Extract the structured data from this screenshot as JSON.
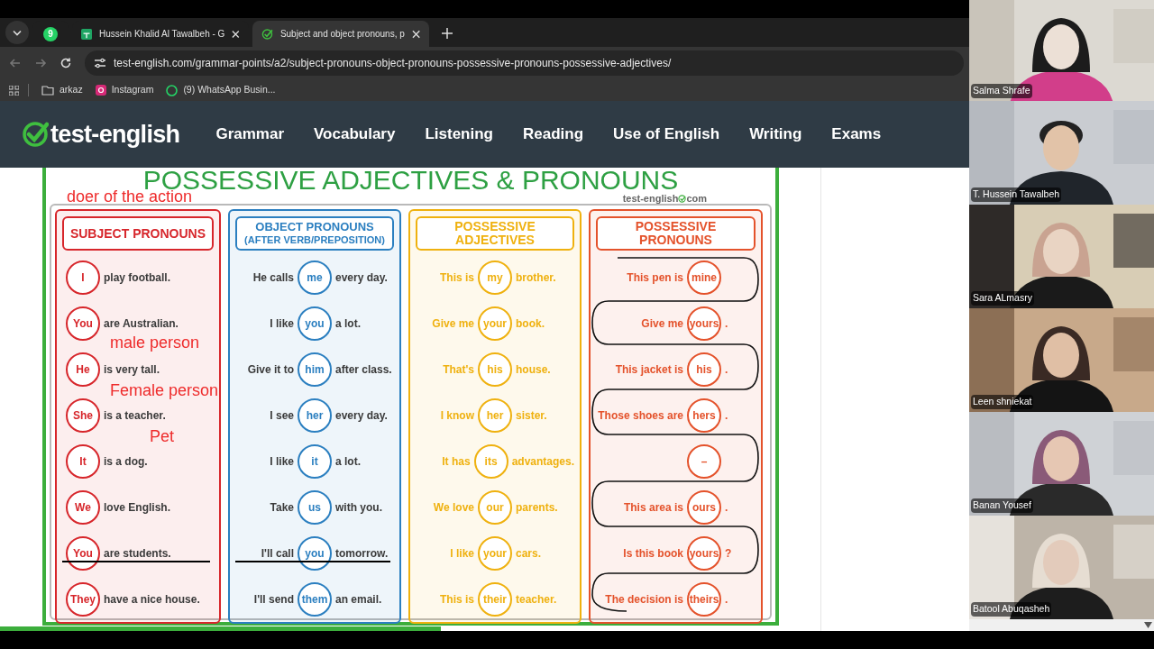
{
  "browser": {
    "tabs": [
      {
        "kind": "pinned",
        "badge": "9",
        "selected": false
      },
      {
        "kind": "sheet",
        "title": "Hussein Khalid Al Tawalbeh - G",
        "selected": false
      },
      {
        "kind": "check",
        "title": "Subject and object pronouns, p",
        "selected": true
      }
    ],
    "url": "test-english.com/grammar-points/a2/subject-pronouns-object-pronouns-possessive-pronouns-possessive-adjectives/",
    "bookmarks": [
      {
        "kind": "folder",
        "label": "arkaz"
      },
      {
        "kind": "instagram",
        "label": "Instagram"
      },
      {
        "kind": "whatsapp",
        "label": "(9) WhatsApp Busin..."
      }
    ]
  },
  "site": {
    "logo": "test-english",
    "nav": [
      "Grammar",
      "Vocabulary",
      "Listening",
      "Reading",
      "Use of English",
      "Writing",
      "Exams"
    ]
  },
  "chart": {
    "title": "POSSESSIVE ADJECTIVES & PRONOUNS",
    "brand": "test-english",
    "brand_suffix": "com",
    "columns": [
      {
        "title": "SUBJECT PRONOUNS",
        "color": "#d7262b",
        "colored_text": false,
        "rows": [
          {
            "word": "I",
            "after": "play football.",
            "struck": false
          },
          {
            "word": "You",
            "after": "are Australian.",
            "struck": false
          },
          {
            "word": "He",
            "after": "is very tall.",
            "struck": false
          },
          {
            "word": "She",
            "after": "is a teacher.",
            "struck": false
          },
          {
            "word": "It",
            "after": "is a dog.",
            "struck": false
          },
          {
            "word": "We",
            "after": "love English.",
            "struck": false
          },
          {
            "word": "You",
            "after": "are students.",
            "struck": true
          },
          {
            "word": "They",
            "after": "have a nice house.",
            "struck": false
          }
        ]
      },
      {
        "title": "OBJECT PRONOUNS",
        "subtitle": "(AFTER VERB/PREPOSITION)",
        "color": "#2b7fc0",
        "colored_text": false,
        "rows": [
          {
            "before": "He calls",
            "word": "me",
            "after": "every day.",
            "struck": false
          },
          {
            "before": "I like",
            "word": "you",
            "after": "a lot.",
            "struck": false
          },
          {
            "before": "Give it to",
            "word": "him",
            "after": "after class.",
            "struck": false
          },
          {
            "before": "I see",
            "word": "her",
            "after": "every day.",
            "struck": false
          },
          {
            "before": "I like",
            "word": "it",
            "after": "a lot.",
            "struck": false
          },
          {
            "before": "Take",
            "word": "us",
            "after": "with you.",
            "struck": false
          },
          {
            "before": "I'll call",
            "word": "you",
            "after": "tomorrow.",
            "struck": true
          },
          {
            "before": "I'll send",
            "word": "them",
            "after": "an email.",
            "struck": false
          }
        ]
      },
      {
        "title": "POSSESSIVE ADJECTIVES",
        "color": "#efb10f",
        "colored_text": true,
        "rows": [
          {
            "before": "This is",
            "word": "my",
            "after": "brother.",
            "struck": false
          },
          {
            "before": "Give me",
            "word": "your",
            "after": "book.",
            "struck": false
          },
          {
            "before": "That's",
            "word": "his",
            "after": "house.",
            "struck": false
          },
          {
            "before": "I know",
            "word": "her",
            "after": "sister.",
            "struck": false
          },
          {
            "before": "It has",
            "word": "its",
            "after": "advantages.",
            "struck": false
          },
          {
            "before": "We love",
            "word": "our",
            "after": "parents.",
            "struck": false
          },
          {
            "before": "I like",
            "word": "your",
            "after": "cars.",
            "struck": false
          },
          {
            "before": "This is",
            "word": "their",
            "after": "teacher.",
            "struck": false
          }
        ]
      },
      {
        "title": "POSSESSIVE PRONOUNS",
        "color": "#e4522b",
        "colored_text": true,
        "rows": [
          {
            "before": "This pen is",
            "word": "mine",
            "struck": false
          },
          {
            "before": "Give me",
            "word": "yours",
            "after": ".",
            "struck": false
          },
          {
            "before": "This jacket is",
            "word": "his",
            "after": ".",
            "struck": false
          },
          {
            "before": "Those shoes are",
            "word": "hers",
            "after": ".",
            "struck": false
          },
          {
            "word": "–",
            "struck": false
          },
          {
            "before": "This area is",
            "word": "ours",
            "after": ".",
            "struck": false
          },
          {
            "before": "Is this book",
            "word": "yours",
            "after": "?",
            "struck": false
          },
          {
            "before": "The decision is",
            "word": "theirs",
            "after": ".",
            "struck": false
          }
        ]
      }
    ]
  },
  "annotations": [
    "doer of the action",
    "male person",
    "Female person",
    "Pet"
  ],
  "reading_progress": {
    "level": 0.455
  },
  "participants": [
    {
      "name": "Salma Shrafe"
    },
    {
      "name": "T. Hussein Tawalbeh"
    },
    {
      "name": "Sara ALmasry"
    },
    {
      "name": "Leen shniekat"
    },
    {
      "name": "Banan Yousef"
    },
    {
      "name": "Batool Abuqasheh"
    }
  ]
}
